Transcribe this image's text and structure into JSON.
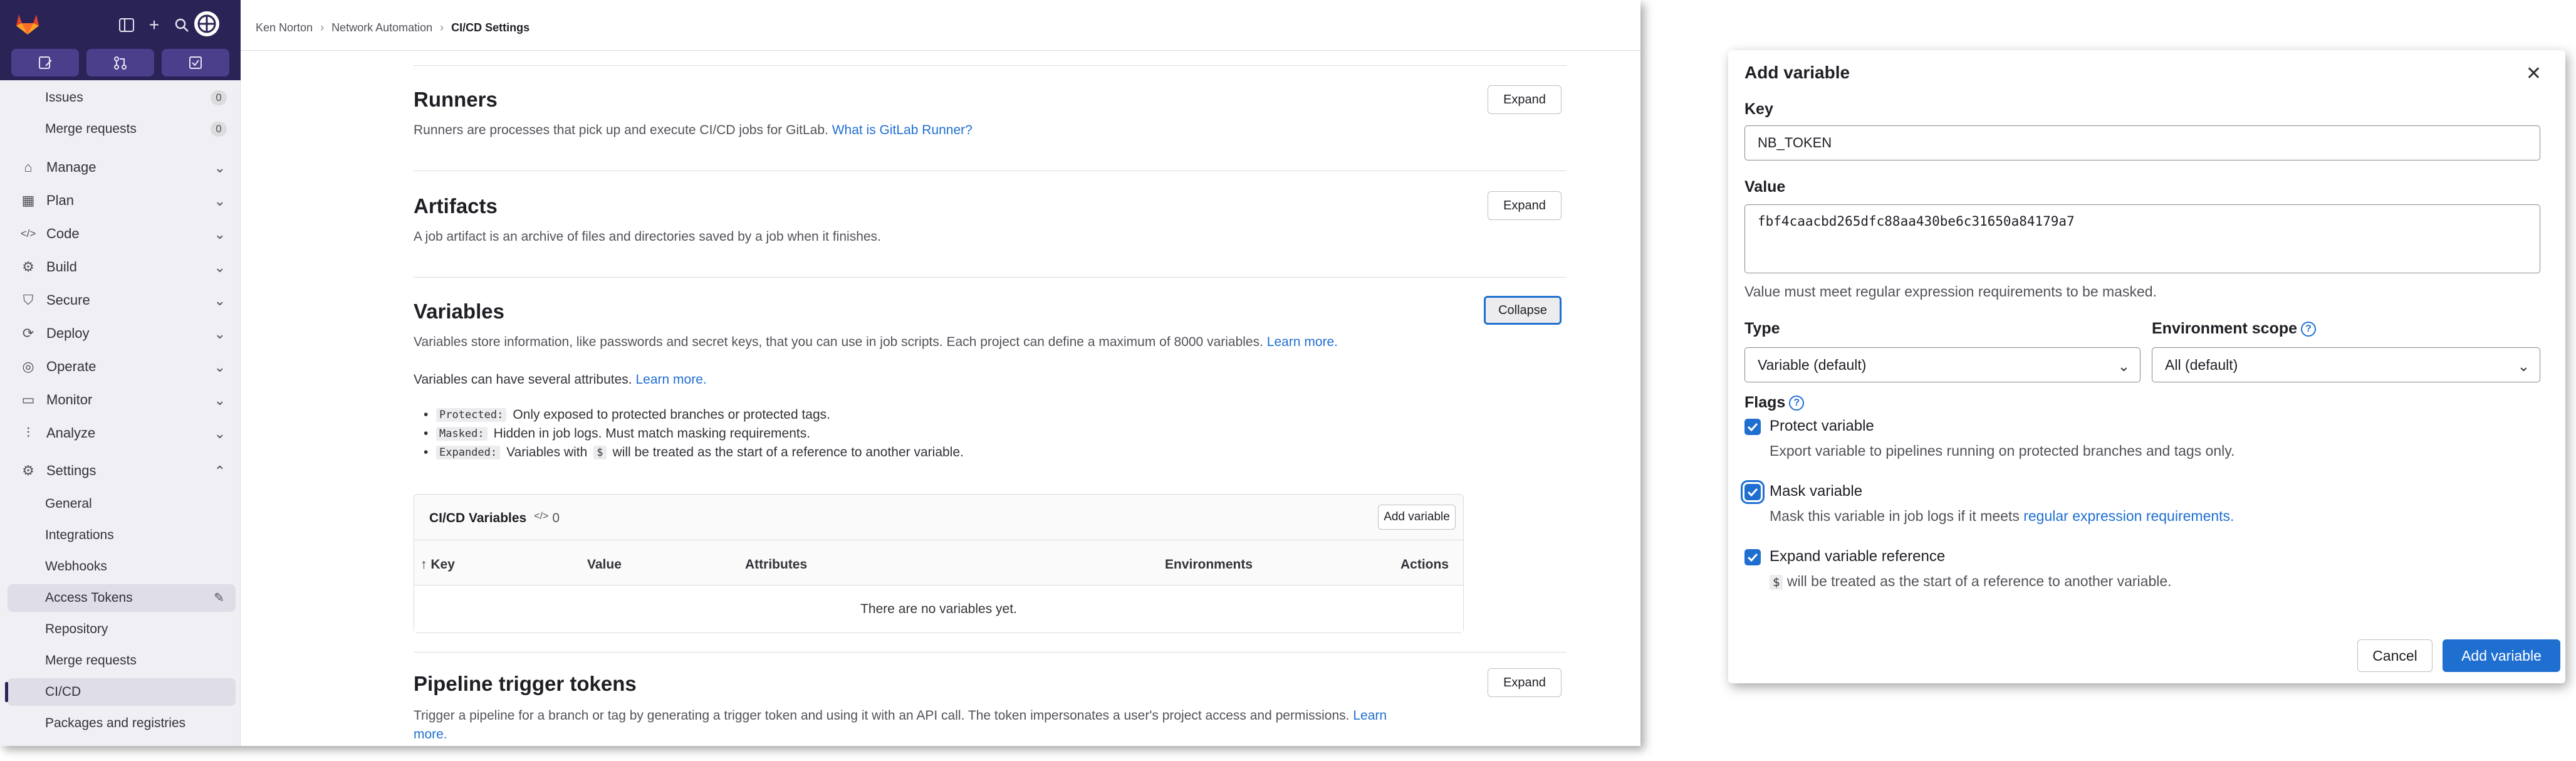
{
  "breadcrumb": [
    "Ken Norton",
    "Network Automation",
    "CI/CD Settings"
  ],
  "sidebar": {
    "top_items": [
      {
        "label": "Issues",
        "count": "0"
      },
      {
        "label": "Merge requests",
        "count": "0"
      }
    ],
    "groups": [
      {
        "label": "Manage",
        "icon": "manage-icon"
      },
      {
        "label": "Plan",
        "icon": "plan-icon"
      },
      {
        "label": "Code",
        "icon": "code-icon"
      },
      {
        "label": "Build",
        "icon": "build-icon"
      },
      {
        "label": "Secure",
        "icon": "shield-icon"
      },
      {
        "label": "Deploy",
        "icon": "deploy-icon"
      },
      {
        "label": "Operate",
        "icon": "operate-icon"
      },
      {
        "label": "Monitor",
        "icon": "monitor-icon"
      },
      {
        "label": "Analyze",
        "icon": "chart-icon"
      },
      {
        "label": "Settings",
        "icon": "gear-icon"
      }
    ],
    "settings_items": [
      "General",
      "Integrations",
      "Webhooks",
      "Access Tokens",
      "Repository",
      "Merge requests",
      "CI/CD",
      "Packages and registries"
    ],
    "active_item": "CI/CD"
  },
  "sections": {
    "runners": {
      "title": "Runners",
      "desc": "Runners are processes that pick up and execute CI/CD jobs for GitLab.",
      "link": "What is GitLab Runner?",
      "button": "Expand"
    },
    "artifacts": {
      "title": "Artifacts",
      "desc": "A job artifact is an archive of files and directories saved by a job when it finishes.",
      "button": "Expand"
    },
    "variables": {
      "title": "Variables",
      "desc": "Variables store information, like passwords and secret keys, that you can use in job scripts. Each project can define a maximum of 8000 variables.",
      "desc_link": "Learn more.",
      "attrs_intro": "Variables can have several attributes.",
      "attrs_link": "Learn more.",
      "button": "Collapse",
      "bullets": [
        {
          "code": "Protected:",
          "text": "Only exposed to protected branches or protected tags."
        },
        {
          "code": "Masked:",
          "text": "Hidden in job logs. Must match masking requirements."
        },
        {
          "code": "Expanded:",
          "pre": "Variables with",
          "code2": "$",
          "text": "will be treated as the start of a reference to another variable."
        }
      ],
      "card": {
        "title": "CI/CD Variables",
        "count": "0",
        "add_button": "Add variable",
        "columns": [
          "Key",
          "Value",
          "Attributes",
          "Environments",
          "Actions"
        ],
        "empty": "There are no variables yet."
      }
    },
    "pipeline": {
      "title": "Pipeline trigger tokens",
      "desc": "Trigger a pipeline for a branch or tag by generating a trigger token and using it with an API call. The token impersonates a user's project access and permissions.",
      "link": "Learn",
      "link2": "more.",
      "button": "Expand"
    }
  },
  "dialog": {
    "title": "Add variable",
    "key_label": "Key",
    "key_value": "NB_TOKEN",
    "value_label": "Value",
    "value_value": "fbf4caacbd265dfc88aa430be6c31650a84179a7",
    "value_help": "Value must meet regular expression requirements to be masked.",
    "type_label": "Type",
    "type_value": "Variable (default)",
    "env_label": "Environment scope",
    "env_value": "All (default)",
    "flags_label": "Flags",
    "flags": [
      {
        "title": "Protect variable",
        "help": "Export variable to pipelines running on protected branches and tags only.",
        "checked": true
      },
      {
        "title": "Mask variable",
        "help": "Mask this variable in job logs if it meets",
        "link": "regular expression requirements.",
        "checked": true
      },
      {
        "title": "Expand variable reference",
        "code": "$",
        "help": "will be treated as the start of a reference to another variable.",
        "checked": true
      }
    ],
    "cancel": "Cancel",
    "submit": "Add variable"
  },
  "colors": {
    "accent": "#1f6fd1",
    "sidebar_top": "#2a2456",
    "logo": "#e24329"
  }
}
